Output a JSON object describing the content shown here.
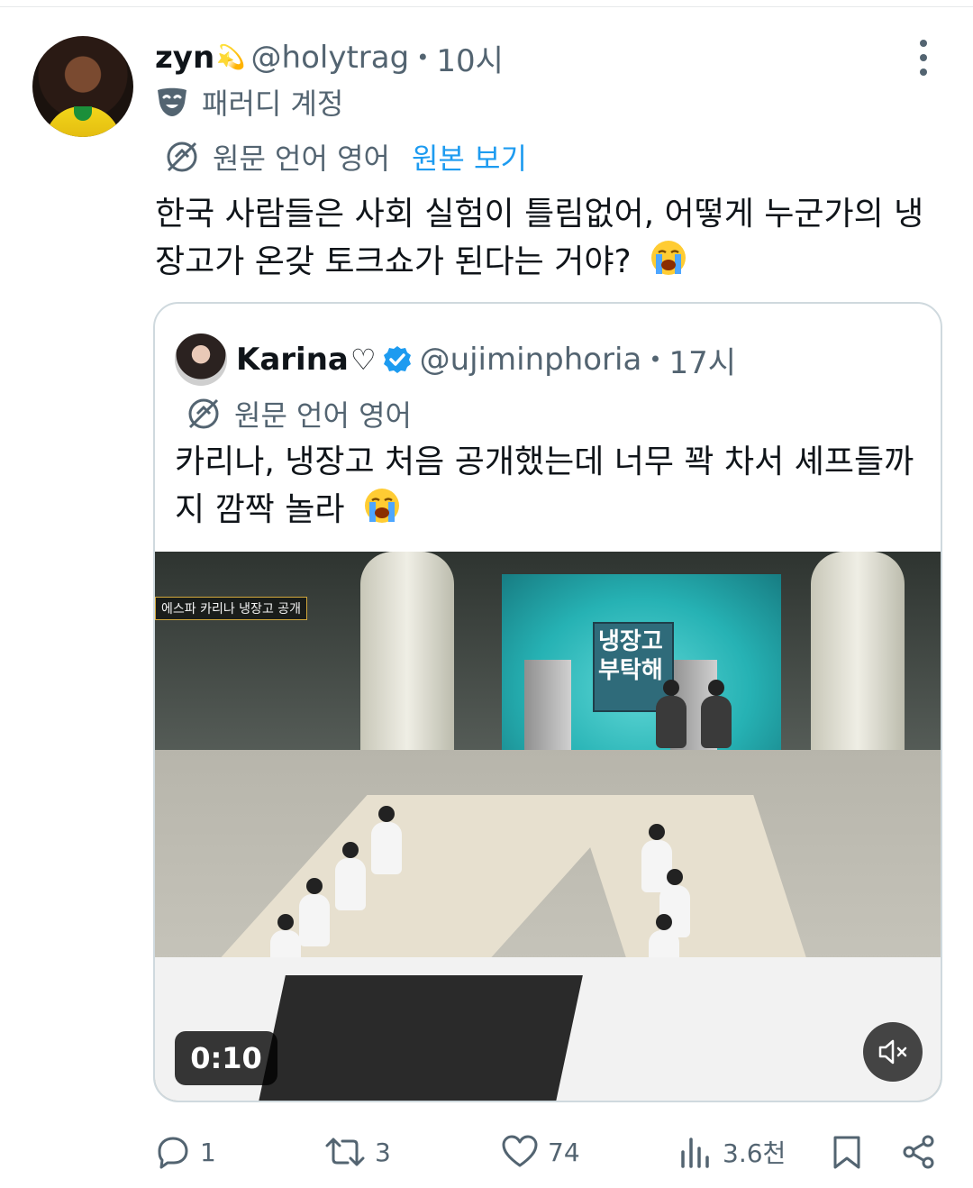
{
  "tweet": {
    "display_name": "zyn",
    "name_emoji": "💫",
    "handle": "@holytrag",
    "separator": "•",
    "time": "10시",
    "parody_label": "패러디 계정",
    "translate": {
      "original_language": "원문 언어 영어",
      "view_original": "원본 보기"
    },
    "text": "한국 사람들은 사회 실험이 틀림없어, 어떻게 누군가의 냉장고가 온갖 토크쇼가 된다는 거야?"
  },
  "quote": {
    "display_name": "Karina",
    "name_suffix": "♡",
    "handle": "@ujiminphoria",
    "separator": "•",
    "time": "17시",
    "original_language": "원문 언어 영어",
    "text": "카리나, 냉장고 처음 공개했는데 너무 꽉 차서 셰프들까지 깜짝 놀라",
    "media": {
      "caption": "에스파 카리나 냉장고 공개",
      "logo_line1": "냉장고",
      "logo_line2": "부탁해",
      "duration": "0:10"
    }
  },
  "actions": {
    "replies": "1",
    "reposts": "3",
    "likes": "74",
    "views": "3.6천"
  },
  "colors": {
    "accent": "#1d9bf0",
    "secondary_text": "#536471",
    "verified": "#1d9bf0"
  }
}
